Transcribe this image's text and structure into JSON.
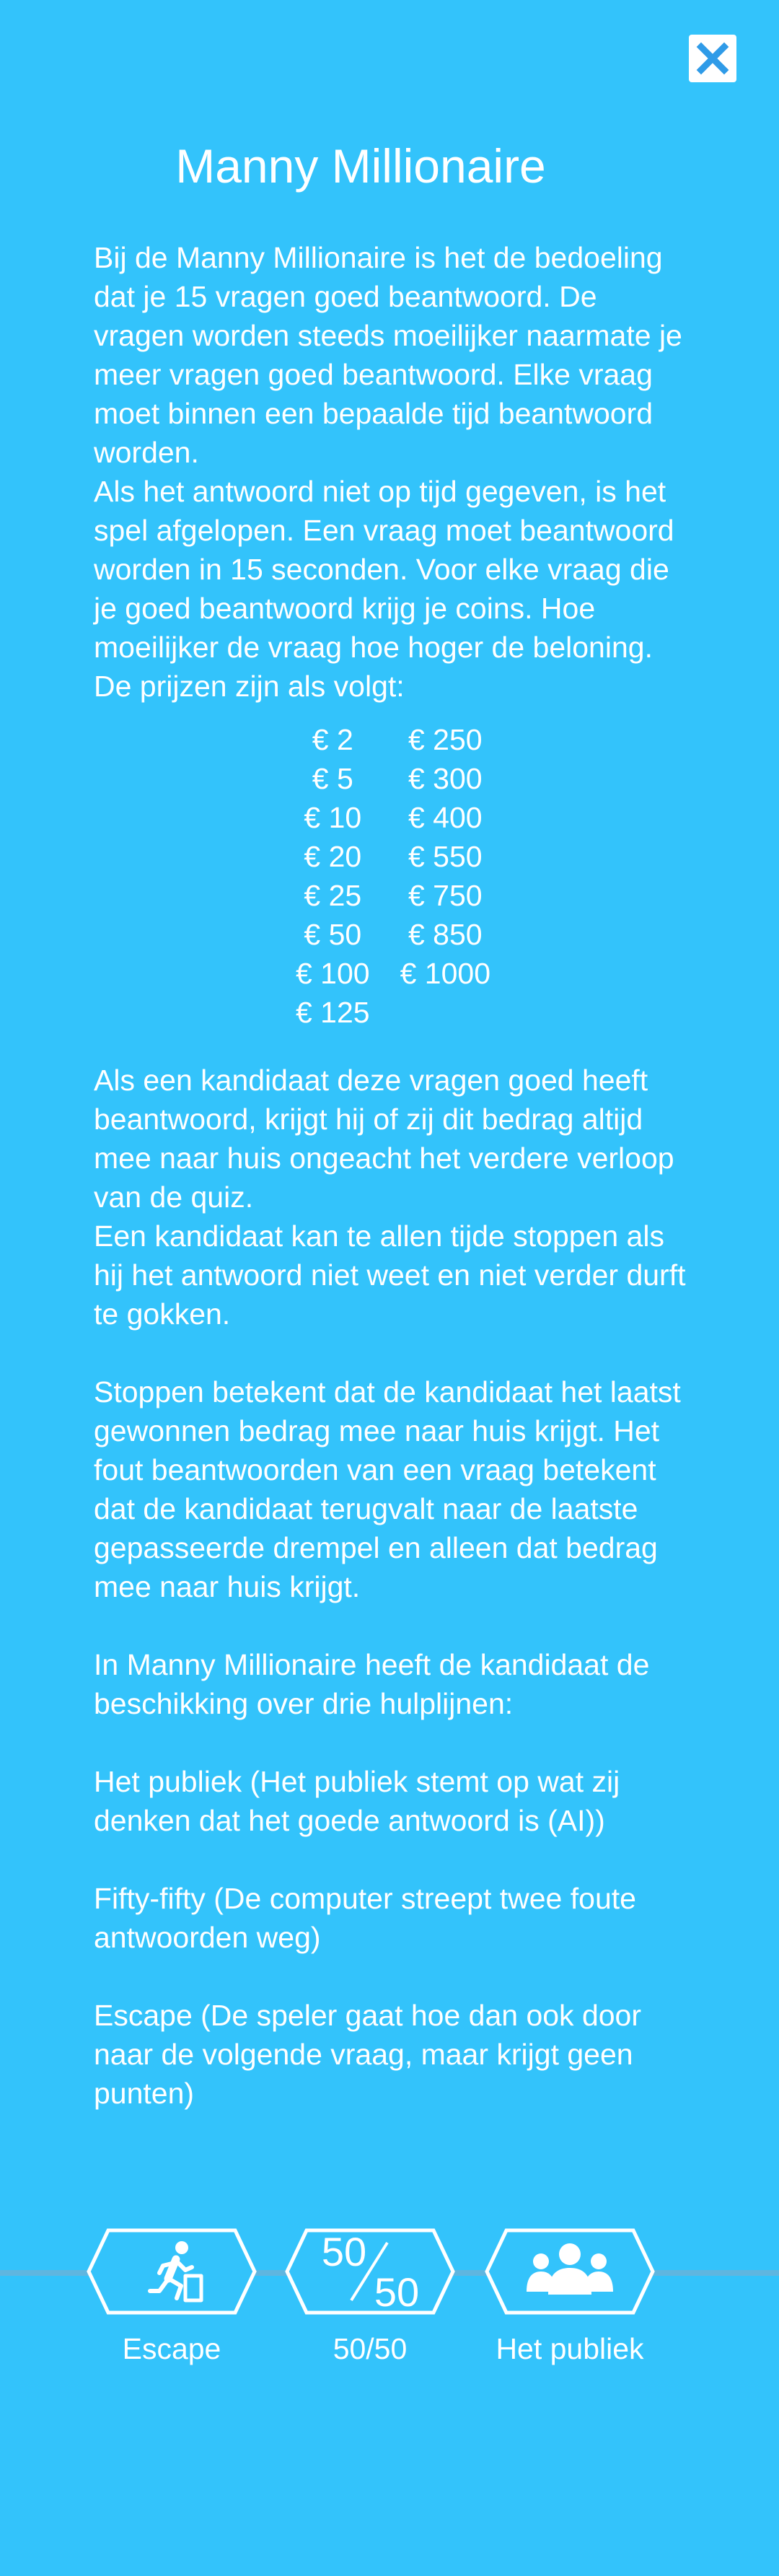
{
  "title": "Manny Millionaire",
  "intro_paragraphs": [
    "Bij de Manny Millionaire is het de bedoeling dat je 15 vragen goed beantwoord. De vragen worden steeds moeilijker naarmate je meer vragen goed beantwoord. Elke vraag moet binnen een bepaalde tijd beantwoord worden.",
    "Als het antwoord niet op tijd gegeven, is het spel afgelopen. Een vraag moet beantwoord worden in 15 seconden. Voor elke vraag die je goed beantwoord krijg je coins. Hoe moeilijker de vraag hoe hoger de beloning.",
    "De prijzen zijn als volgt:"
  ],
  "prizes_left": [
    "€ 2",
    "€ 5",
    "€ 10",
    "€ 20",
    "€ 25",
    "€ 50",
    "€ 100",
    "€ 125"
  ],
  "prizes_right": [
    "€ 250",
    "€ 300",
    "€ 400",
    "€ 550",
    "€ 750",
    "€ 850",
    "€ 1000"
  ],
  "body_paragraphs": [
    "Als een kandidaat deze vragen goed heeft beantwoord, krijgt hij of zij dit bedrag altijd mee naar huis ongeacht het verdere verloop van de quiz.",
    "Een kandidaat kan te allen tijde stoppen als hij het antwoord niet weet en niet verder durft te gokken."
  ],
  "stop_paragraph": "Stoppen betekent dat de kandidaat het laatst gewonnen bedrag mee naar huis krijgt. Het fout beantwoorden van een vraag betekent dat de kandidaat terugvalt naar de laatste gepasseerde drempel en alleen dat bedrag mee naar huis krijgt.",
  "lifelines_intro": "In Manny Millionaire heeft  de kandidaat de beschikking over drie hulplijnen:",
  "lifeline_descriptions": [
    "Het publiek (Het publiek stemt op wat zij denken dat het goede antwoord is (AI))",
    "Fifty-fifty (De computer streept twee foute antwoorden weg)",
    "Escape (De speler gaat hoe dan ook door naar de volgende vraag, maar krijgt geen punten)"
  ],
  "lifelines": [
    {
      "label": "Escape",
      "icon": "running-person-icon"
    },
    {
      "label": "50/50",
      "icon": "fifty-fifty-icon",
      "icon_top": "50",
      "icon_bottom": "50"
    },
    {
      "label": "Het publiek",
      "icon": "audience-icon"
    }
  ],
  "close_icon": "close-icon",
  "colors": {
    "background": "#33c3fb",
    "text": "#ffffff",
    "accent": "#2f9be8",
    "line": "#5fb6e0"
  }
}
